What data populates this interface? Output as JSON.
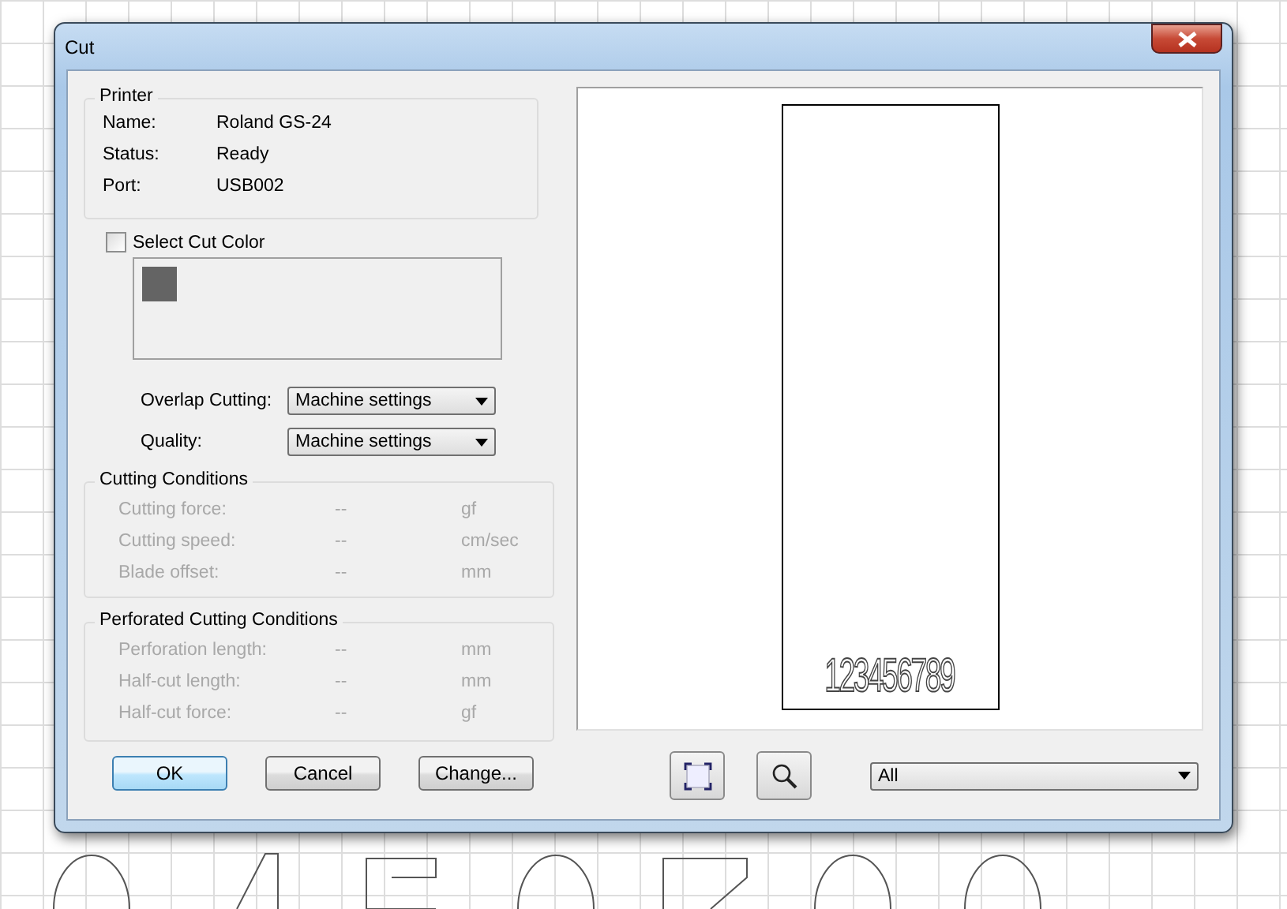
{
  "window": {
    "title": "Cut"
  },
  "printer": {
    "title": "Printer",
    "rows": [
      {
        "label": "Name:",
        "value": "Roland GS-24"
      },
      {
        "label": "Status:",
        "value": "Ready"
      },
      {
        "label": "Port:",
        "value": "USB002"
      }
    ]
  },
  "cut_color": {
    "label": "Select Cut Color",
    "checked": false,
    "swatches": [
      {
        "color": "#646464"
      }
    ]
  },
  "options": [
    {
      "label": "Overlap Cutting:",
      "value": "Machine settings"
    },
    {
      "label": "Quality:",
      "value": "Machine settings"
    }
  ],
  "cutting_conditions": {
    "title": "Cutting Conditions",
    "disabled": true,
    "rows": [
      {
        "label": "Cutting force:",
        "value": "--",
        "unit": "gf"
      },
      {
        "label": "Cutting speed:",
        "value": "--",
        "unit": "cm/sec"
      },
      {
        "label": "Blade offset:",
        "value": "--",
        "unit": "mm"
      }
    ]
  },
  "perforated_conditions": {
    "title": "Perforated Cutting Conditions",
    "disabled": true,
    "rows": [
      {
        "label": "Perforation length:",
        "value": "--",
        "unit": "mm"
      },
      {
        "label": "Half-cut length:",
        "value": "--",
        "unit": "mm"
      },
      {
        "label": "Half-cut force:",
        "value": "--",
        "unit": "gf"
      }
    ]
  },
  "buttons": [
    {
      "label": "OK",
      "default": true
    },
    {
      "label": "Cancel",
      "default": false
    },
    {
      "label": "Change...",
      "default": false
    }
  ],
  "preview": {
    "text": "123456789"
  },
  "view_select": {
    "value": "All"
  }
}
